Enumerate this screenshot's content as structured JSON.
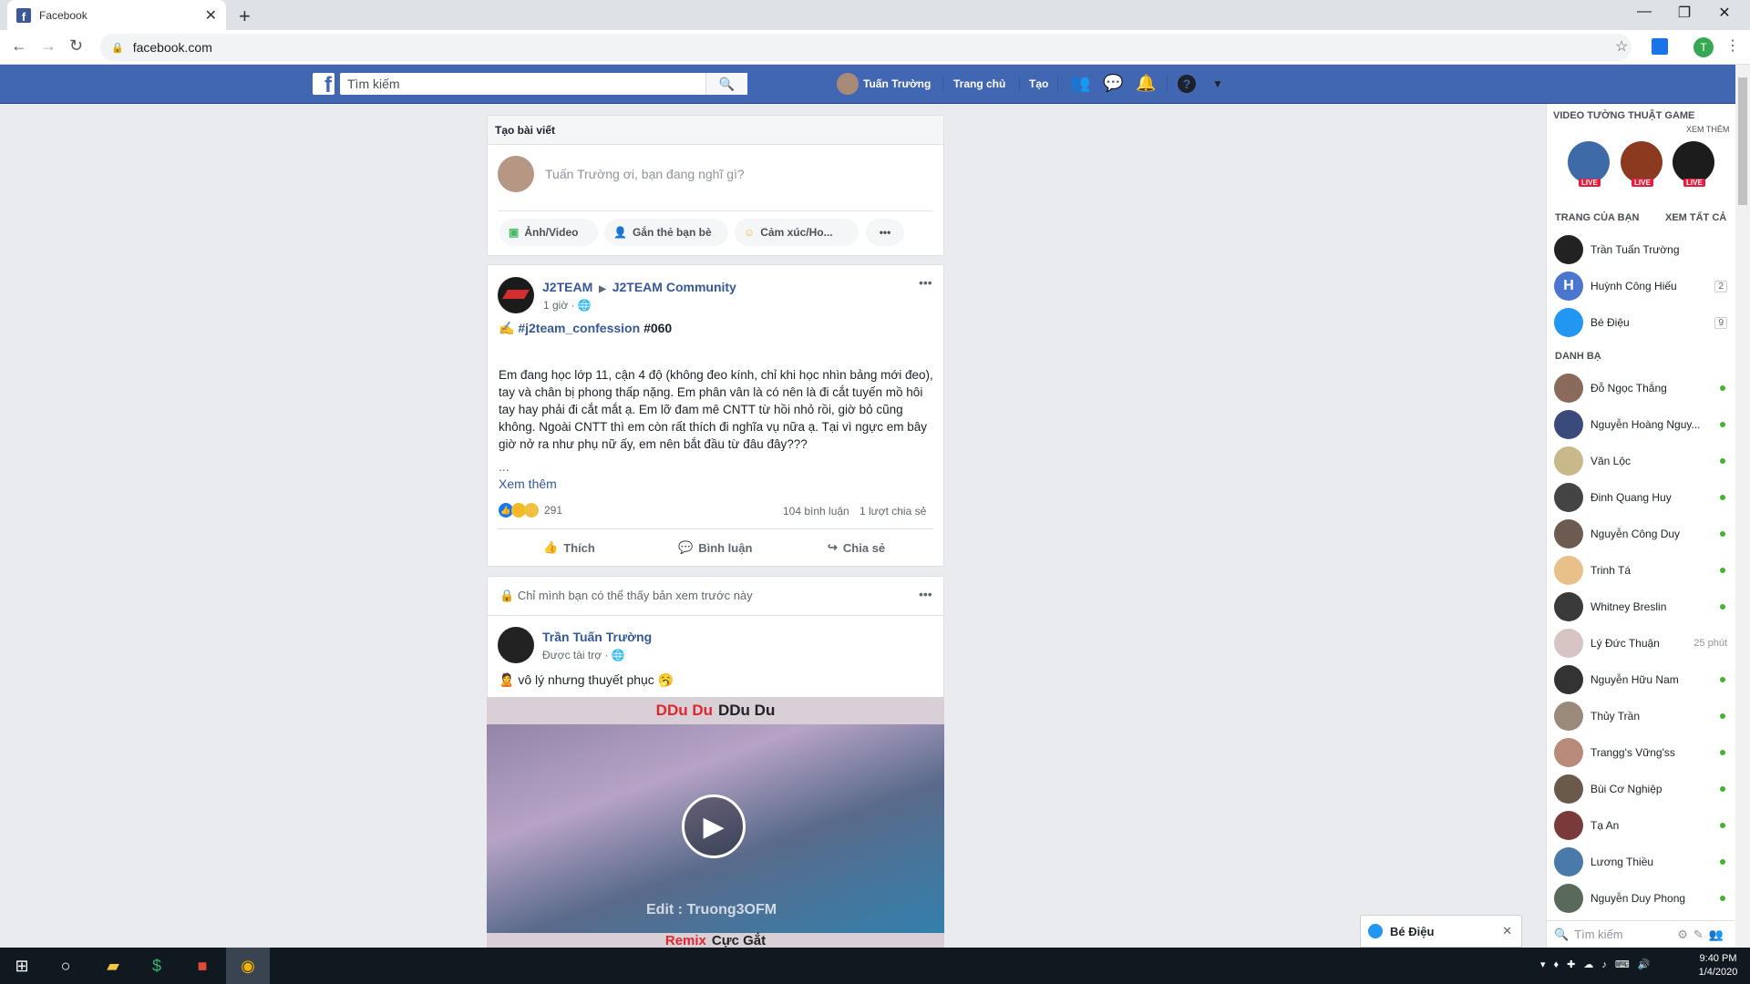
{
  "browser": {
    "tab_title": "Facebook",
    "tab_close": "✕",
    "new_tab": "+",
    "url": "facebook.com",
    "profile_initial": "T",
    "win_min": "—",
    "win_max": "❐",
    "win_close": "✕"
  },
  "fb_header": {
    "logo": "f",
    "search_placeholder": "Tìm kiếm",
    "user_name": "Tuấn Trường",
    "home": "Trang chủ",
    "create": "Tạo"
  },
  "composer": {
    "title": "Tạo bài viết",
    "prompt": "Tuấn Trường ơi, bạn đang nghĩ gì?",
    "photo_video": "Ảnh/Video",
    "tag_friends": "Gắn thẻ bạn bè",
    "feeling": "Cảm xúc/Ho...",
    "more": "•••"
  },
  "post1": {
    "author": "J2TEAM",
    "group": "J2TEAM Community",
    "time": "1 giờ",
    "hashtag": "#j2team_confession",
    "number": "#060",
    "body": "Em đang học lớp 11, cận 4 độ (không đeo kính, chỉ khi học nhìn bảng mới đeo), tay và chân bị phong thấp nặng. Em phân vân là có nên là đi cắt tuyến mồ hôi tay hay phải đi cắt mắt ạ. Em lỡ đam mê CNTT từ hồi nhỏ rồi, giờ bỏ cũng không. Ngoài CNTT thì em còn rất thích đi nghĩa vụ nữa ạ. Tại vì ngực em bây giờ nở ra như phụ nữ ấy, em nên bắt đầu từ đâu đây???",
    "ellipsis": "...",
    "see_more": "Xem thêm",
    "reactions": "291",
    "comments": "104 bình luận",
    "shares": "1 lượt chia sẻ",
    "like": "Thích",
    "comment": "Bình luận",
    "share": "Chia sẻ",
    "menu": "•••"
  },
  "post2": {
    "notice": "Chỉ mình bạn có thể thấy bản xem trước này",
    "author": "Trần Tuấn Trường",
    "sponsored": "Được tài trợ ·",
    "text": "vô lý nhưng thuyết phục",
    "video_top_red": "DDu Du",
    "video_top_black": "DDu Du",
    "video_watermark": "Edit : Truong3OFM",
    "video_bottom_red": "Remix",
    "video_bottom_black": "Cực Gắt",
    "menu": "•••"
  },
  "sidebar": {
    "videos_title": "VIDEO TƯỜNG THUẬT GAME",
    "see_more": "XEM THÊM",
    "live_label": "LIVE",
    "pages_title": "TRANG CỦA BẠN",
    "see_all": "XEM TẤT CẢ",
    "pages": [
      {
        "name": "Trần Tuấn Trường",
        "badge": ""
      },
      {
        "name": "Huỳnh Công Hiếu",
        "badge": "2"
      },
      {
        "name": "Bé Điệu",
        "badge": "9"
      }
    ],
    "contacts_title": "DANH BẠ",
    "contacts": [
      {
        "name": "Đỗ Ngọc Thắng",
        "status": "online"
      },
      {
        "name": "Nguyễn Hoàng Nguy...",
        "status": "online"
      },
      {
        "name": "Văn Lộc",
        "status": "online"
      },
      {
        "name": "Đinh Quang Huy",
        "status": "online"
      },
      {
        "name": "Nguyễn Công Duy",
        "status": "online"
      },
      {
        "name": "Trinh Tá",
        "status": "online"
      },
      {
        "name": "Whitney Breslin",
        "status": "online"
      },
      {
        "name": "Lý Đức Thuận",
        "status": "25 phút"
      },
      {
        "name": "Nguyễn Hữu Nam",
        "status": "online"
      },
      {
        "name": "Thủy Trần",
        "status": "online"
      },
      {
        "name": "Trangg's Vững'ss",
        "status": "online"
      },
      {
        "name": "Bùi Cơ Nghiệp",
        "status": "online"
      },
      {
        "name": "Tạ An",
        "status": "online"
      },
      {
        "name": "Lương Thiều",
        "status": "online"
      },
      {
        "name": "Nguyễn Duy Phong",
        "status": "online"
      }
    ],
    "search_placeholder": "Tìm kiếm"
  },
  "chat_tab": {
    "name": "Bé Điệu",
    "close": "✕"
  },
  "taskbar": {
    "time": "9:40 PM",
    "date": "1/4/2020"
  }
}
